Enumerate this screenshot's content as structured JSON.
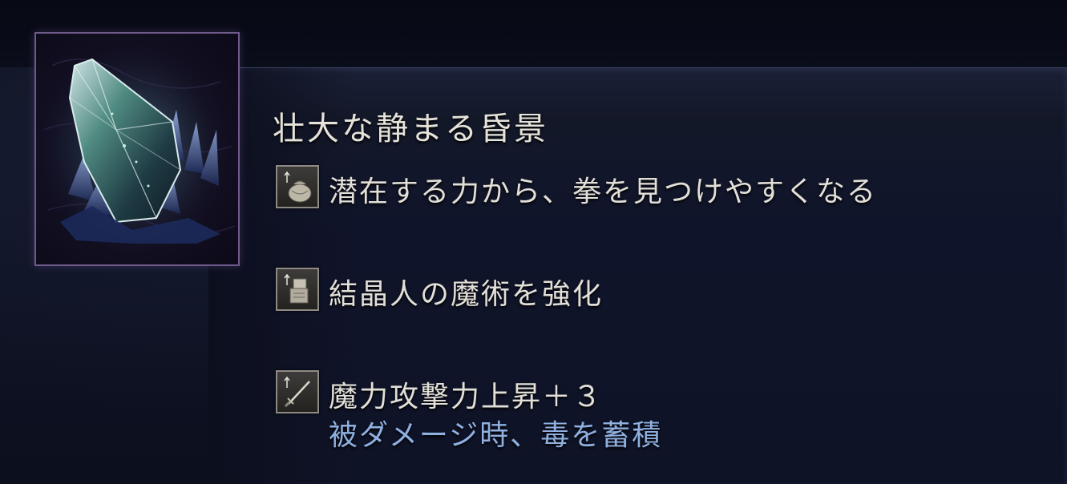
{
  "item": {
    "name": "壮大な静まる昏景",
    "icon": "crystal-relic-icon"
  },
  "effects": [
    {
      "icon": "rune-pouch-icon",
      "text": "潜在する力から、拳を見つけやすくなる"
    },
    {
      "icon": "sorcery-scroll-icon",
      "text": "結晶人の魔術を強化"
    },
    {
      "icon": "sword-icon",
      "text": "魔力攻撃力上昇＋３",
      "sub": "被ダメージ時、毒を蓄積"
    }
  ],
  "colors": {
    "title": "#e6e3da",
    "effect_text": "#e2dfd8",
    "negative_effect": "#8fb0e0",
    "frame_border": "#6f5a8a"
  }
}
